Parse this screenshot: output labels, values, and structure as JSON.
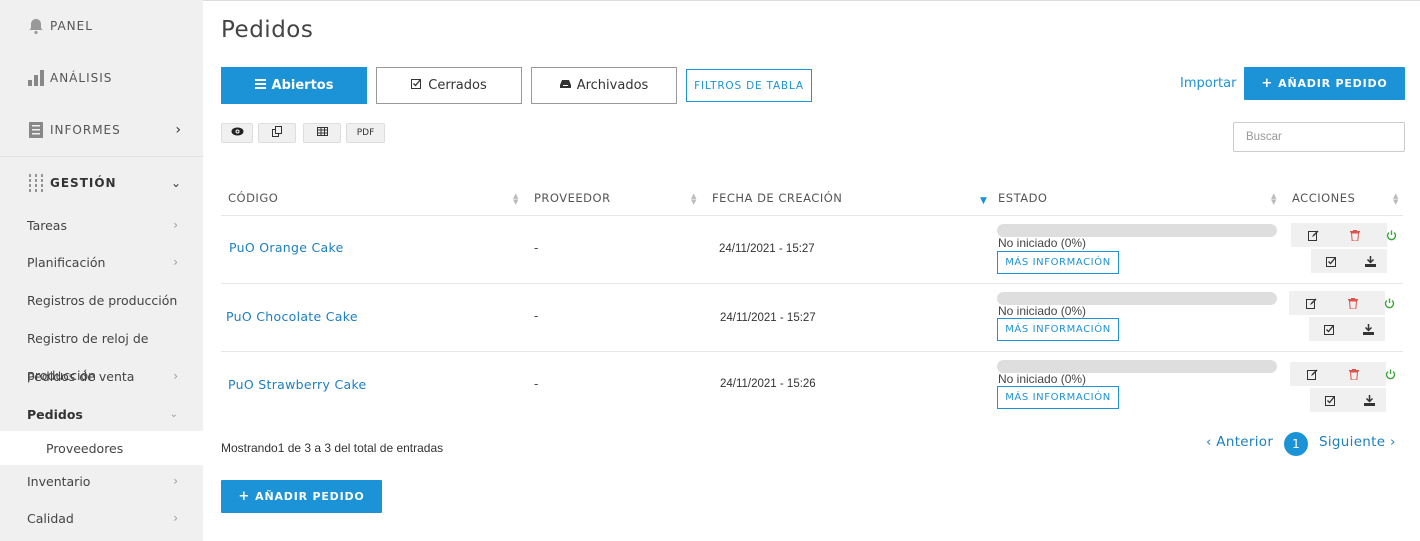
{
  "sidebar": {
    "top_items": [
      {
        "label": "PANEL",
        "icon": "bell-icon"
      },
      {
        "label": "ANÁLISIS",
        "icon": "bar-chart-icon"
      },
      {
        "label": "INFORMES",
        "icon": "document-icon"
      },
      {
        "label": "GESTIÓN",
        "icon": "sliders-icon"
      }
    ],
    "sub_items": [
      {
        "label": "Tareas"
      },
      {
        "label": "Planificación"
      },
      {
        "label": "Registros de producción"
      },
      {
        "label": "Registro de reloj de"
      },
      {
        "label": "Pedidos de venta"
      },
      {
        "label": "Pedidos"
      },
      {
        "label": "Proveedores"
      },
      {
        "label": "Inventario"
      },
      {
        "label": "Calidad"
      }
    ],
    "overlap_text": "producción"
  },
  "header": {
    "title": "Pedidos"
  },
  "tabs": [
    {
      "label": "Abiertos",
      "icon": "list-icon"
    },
    {
      "label": "Cerrados",
      "icon": "checkbox-icon"
    },
    {
      "label": "Archivados",
      "icon": "inbox-icon"
    }
  ],
  "toolbar": {
    "filters_label": "FILTROS DE TABLA",
    "import_label": "Importar",
    "add_label": "AÑADIR PEDIDO",
    "pdf_label": "PDF",
    "search_placeholder": "Buscar"
  },
  "table": {
    "columns": [
      "CÓDIGO",
      "PROVEEDOR",
      "FECHA DE CREACIÓN",
      "ESTADO",
      "ACCIONES"
    ],
    "rows": [
      {
        "code": "PuO Orange Cake",
        "supplier": "-",
        "date": "24/11/2021 - 15:27",
        "status": "No iniciado (0%)",
        "progress": 0,
        "more": "MÁS INFORMACIÓN"
      },
      {
        "code": "PuO Chocolate Cake",
        "supplier": "-",
        "date": "24/11/2021 - 15:27",
        "status": "No iniciado (0%)",
        "progress": 0,
        "more": "MÁS INFORMACIÓN"
      },
      {
        "code": "PuO Strawberry Cake",
        "supplier": "-",
        "date": "24/11/2021 - 15:26",
        "status": "No iniciado (0%)",
        "progress": 0,
        "more": "MÁS INFORMACIÓN"
      }
    ]
  },
  "footer": {
    "showing": "Mostrando1 de 3 a 3 del total de entradas",
    "prev": "Anterior",
    "next": "Siguiente",
    "page": "1",
    "add_label": "AÑADIR PEDIDO"
  },
  "colors": {
    "accent": "#1c93d6",
    "link": "#1c7fc0",
    "delete": "#e0534a",
    "power": "#3ba63b",
    "sidebar_bg": "#f0f0f0"
  }
}
